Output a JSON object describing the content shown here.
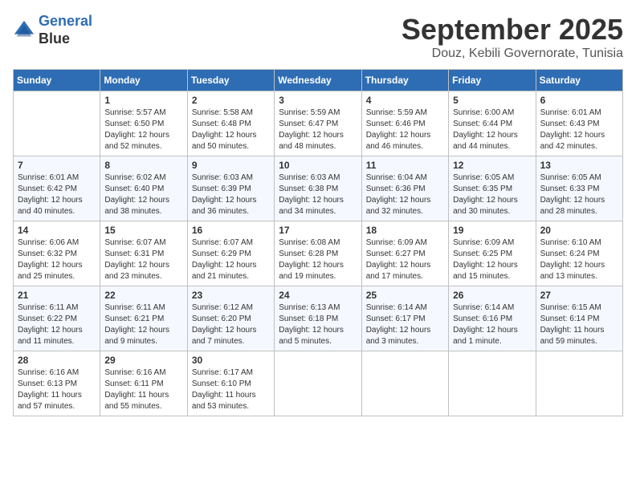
{
  "logo": {
    "line1": "General",
    "line2": "Blue"
  },
  "title": "September 2025",
  "subtitle": "Douz, Kebili Governorate, Tunisia",
  "days_header": [
    "Sunday",
    "Monday",
    "Tuesday",
    "Wednesday",
    "Thursday",
    "Friday",
    "Saturday"
  ],
  "weeks": [
    [
      {
        "num": "",
        "info": ""
      },
      {
        "num": "1",
        "info": "Sunrise: 5:57 AM\nSunset: 6:50 PM\nDaylight: 12 hours\nand 52 minutes."
      },
      {
        "num": "2",
        "info": "Sunrise: 5:58 AM\nSunset: 6:48 PM\nDaylight: 12 hours\nand 50 minutes."
      },
      {
        "num": "3",
        "info": "Sunrise: 5:59 AM\nSunset: 6:47 PM\nDaylight: 12 hours\nand 48 minutes."
      },
      {
        "num": "4",
        "info": "Sunrise: 5:59 AM\nSunset: 6:46 PM\nDaylight: 12 hours\nand 46 minutes."
      },
      {
        "num": "5",
        "info": "Sunrise: 6:00 AM\nSunset: 6:44 PM\nDaylight: 12 hours\nand 44 minutes."
      },
      {
        "num": "6",
        "info": "Sunrise: 6:01 AM\nSunset: 6:43 PM\nDaylight: 12 hours\nand 42 minutes."
      }
    ],
    [
      {
        "num": "7",
        "info": "Sunrise: 6:01 AM\nSunset: 6:42 PM\nDaylight: 12 hours\nand 40 minutes."
      },
      {
        "num": "8",
        "info": "Sunrise: 6:02 AM\nSunset: 6:40 PM\nDaylight: 12 hours\nand 38 minutes."
      },
      {
        "num": "9",
        "info": "Sunrise: 6:03 AM\nSunset: 6:39 PM\nDaylight: 12 hours\nand 36 minutes."
      },
      {
        "num": "10",
        "info": "Sunrise: 6:03 AM\nSunset: 6:38 PM\nDaylight: 12 hours\nand 34 minutes."
      },
      {
        "num": "11",
        "info": "Sunrise: 6:04 AM\nSunset: 6:36 PM\nDaylight: 12 hours\nand 32 minutes."
      },
      {
        "num": "12",
        "info": "Sunrise: 6:05 AM\nSunset: 6:35 PM\nDaylight: 12 hours\nand 30 minutes."
      },
      {
        "num": "13",
        "info": "Sunrise: 6:05 AM\nSunset: 6:33 PM\nDaylight: 12 hours\nand 28 minutes."
      }
    ],
    [
      {
        "num": "14",
        "info": "Sunrise: 6:06 AM\nSunset: 6:32 PM\nDaylight: 12 hours\nand 25 minutes."
      },
      {
        "num": "15",
        "info": "Sunrise: 6:07 AM\nSunset: 6:31 PM\nDaylight: 12 hours\nand 23 minutes."
      },
      {
        "num": "16",
        "info": "Sunrise: 6:07 AM\nSunset: 6:29 PM\nDaylight: 12 hours\nand 21 minutes."
      },
      {
        "num": "17",
        "info": "Sunrise: 6:08 AM\nSunset: 6:28 PM\nDaylight: 12 hours\nand 19 minutes."
      },
      {
        "num": "18",
        "info": "Sunrise: 6:09 AM\nSunset: 6:27 PM\nDaylight: 12 hours\nand 17 minutes."
      },
      {
        "num": "19",
        "info": "Sunrise: 6:09 AM\nSunset: 6:25 PM\nDaylight: 12 hours\nand 15 minutes."
      },
      {
        "num": "20",
        "info": "Sunrise: 6:10 AM\nSunset: 6:24 PM\nDaylight: 12 hours\nand 13 minutes."
      }
    ],
    [
      {
        "num": "21",
        "info": "Sunrise: 6:11 AM\nSunset: 6:22 PM\nDaylight: 12 hours\nand 11 minutes."
      },
      {
        "num": "22",
        "info": "Sunrise: 6:11 AM\nSunset: 6:21 PM\nDaylight: 12 hours\nand 9 minutes."
      },
      {
        "num": "23",
        "info": "Sunrise: 6:12 AM\nSunset: 6:20 PM\nDaylight: 12 hours\nand 7 minutes."
      },
      {
        "num": "24",
        "info": "Sunrise: 6:13 AM\nSunset: 6:18 PM\nDaylight: 12 hours\nand 5 minutes."
      },
      {
        "num": "25",
        "info": "Sunrise: 6:14 AM\nSunset: 6:17 PM\nDaylight: 12 hours\nand 3 minutes."
      },
      {
        "num": "26",
        "info": "Sunrise: 6:14 AM\nSunset: 6:16 PM\nDaylight: 12 hours\nand 1 minute."
      },
      {
        "num": "27",
        "info": "Sunrise: 6:15 AM\nSunset: 6:14 PM\nDaylight: 11 hours\nand 59 minutes."
      }
    ],
    [
      {
        "num": "28",
        "info": "Sunrise: 6:16 AM\nSunset: 6:13 PM\nDaylight: 11 hours\nand 57 minutes."
      },
      {
        "num": "29",
        "info": "Sunrise: 6:16 AM\nSunset: 6:11 PM\nDaylight: 11 hours\nand 55 minutes."
      },
      {
        "num": "30",
        "info": "Sunrise: 6:17 AM\nSunset: 6:10 PM\nDaylight: 11 hours\nand 53 minutes."
      },
      {
        "num": "",
        "info": ""
      },
      {
        "num": "",
        "info": ""
      },
      {
        "num": "",
        "info": ""
      },
      {
        "num": "",
        "info": ""
      }
    ]
  ]
}
